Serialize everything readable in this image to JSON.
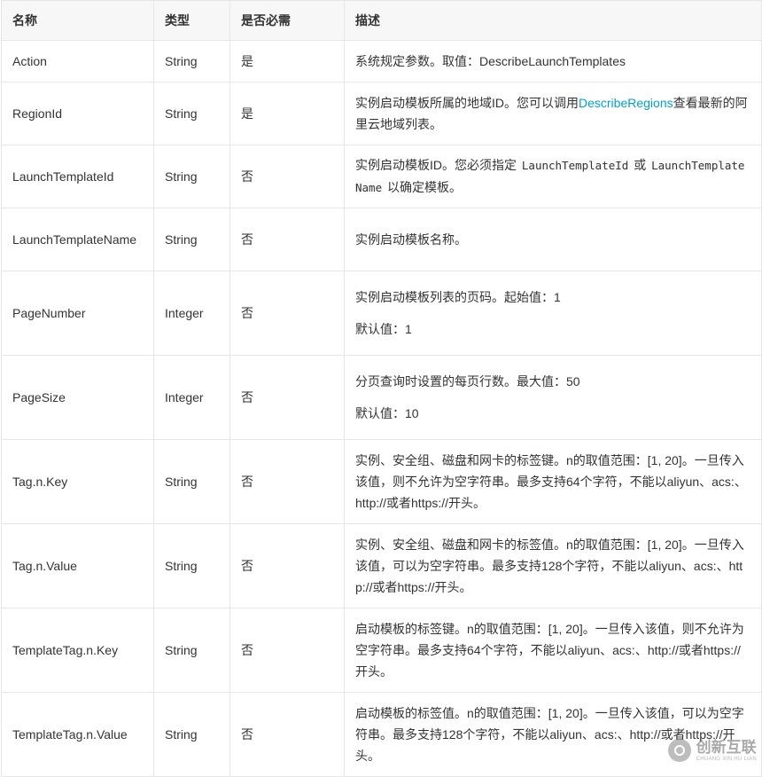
{
  "table": {
    "headers": {
      "name": "名称",
      "type": "类型",
      "required": "是否必需",
      "desc": "描述"
    },
    "rows": [
      {
        "name": "Action",
        "type": "String",
        "required": "是",
        "desc": [
          [
            "系统规定参数。取值：DescribeLaunchTemplates"
          ]
        ]
      },
      {
        "name": "RegionId",
        "type": "String",
        "required": "是",
        "desc": [
          [
            "实例启动模板所属的地域ID。您可以调用",
            "DescribeRegions",
            "查看最新的阿里云地域列表。"
          ]
        ]
      },
      {
        "name": "LaunchTemplateId",
        "type": "String",
        "required": "否",
        "desc": [
          [
            "实例启动模板ID。您必须指定 ",
            "LaunchTemplateId",
            " 或 ",
            "LaunchTemplateName",
            " 以确定模板。"
          ]
        ]
      },
      {
        "name": "LaunchTemplateName",
        "type": "String",
        "required": "否",
        "desc": [
          [
            "实例启动模板名称。"
          ]
        ]
      },
      {
        "name": "PageNumber",
        "type": "Integer",
        "required": "否",
        "desc": [
          [
            "实例启动模板列表的页码。起始值：1"
          ],
          [
            "默认值：1"
          ]
        ]
      },
      {
        "name": "PageSize",
        "type": "Integer",
        "required": "否",
        "desc": [
          [
            "分页查询时设置的每页行数。最大值：50"
          ],
          [
            "默认值：10"
          ]
        ]
      },
      {
        "name": "Tag.n.Key",
        "type": "String",
        "required": "否",
        "desc": [
          [
            "实例、安全组、磁盘和网卡的标签键。n的取值范围：[1, 20]。一旦传入该值，则不允许为空字符串。最多支持64个字符，不能以aliyun、acs:、http://或者https://开头。"
          ]
        ]
      },
      {
        "name": "Tag.n.Value",
        "type": "String",
        "required": "否",
        "desc": [
          [
            "实例、安全组、磁盘和网卡的标签值。n的取值范围：[1, 20]。一旦传入该值，可以为空字符串。最多支持128个字符，不能以aliyun、acs:、http://或者https://开头。"
          ]
        ]
      },
      {
        "name": "TemplateTag.n.Key",
        "type": "String",
        "required": "否",
        "desc": [
          [
            "启动模板的标签键。n的取值范围：[1, 20]。一旦传入该值，则不允许为空字符串。最多支持64个字符，不能以aliyun、acs:、http://或者https://开头。"
          ]
        ]
      },
      {
        "name": "TemplateTag.n.Value",
        "type": "String",
        "required": "否",
        "desc": [
          [
            "启动模板的标签值。n的取值范围：[1, 20]。一旦传入该值，可以为空字符串。最多支持128个字符，不能以aliyun、acs:、http://或者https://开头。"
          ]
        ]
      }
    ]
  },
  "watermark": {
    "cn": "创新互联",
    "en": "CHUANG XIN HU LIAN",
    "icon": "logo-icon"
  },
  "colors": {
    "link": "#00a2ca",
    "header_bg": "#f7f7f7",
    "border": "#e6e6e6",
    "text": "#333333"
  }
}
